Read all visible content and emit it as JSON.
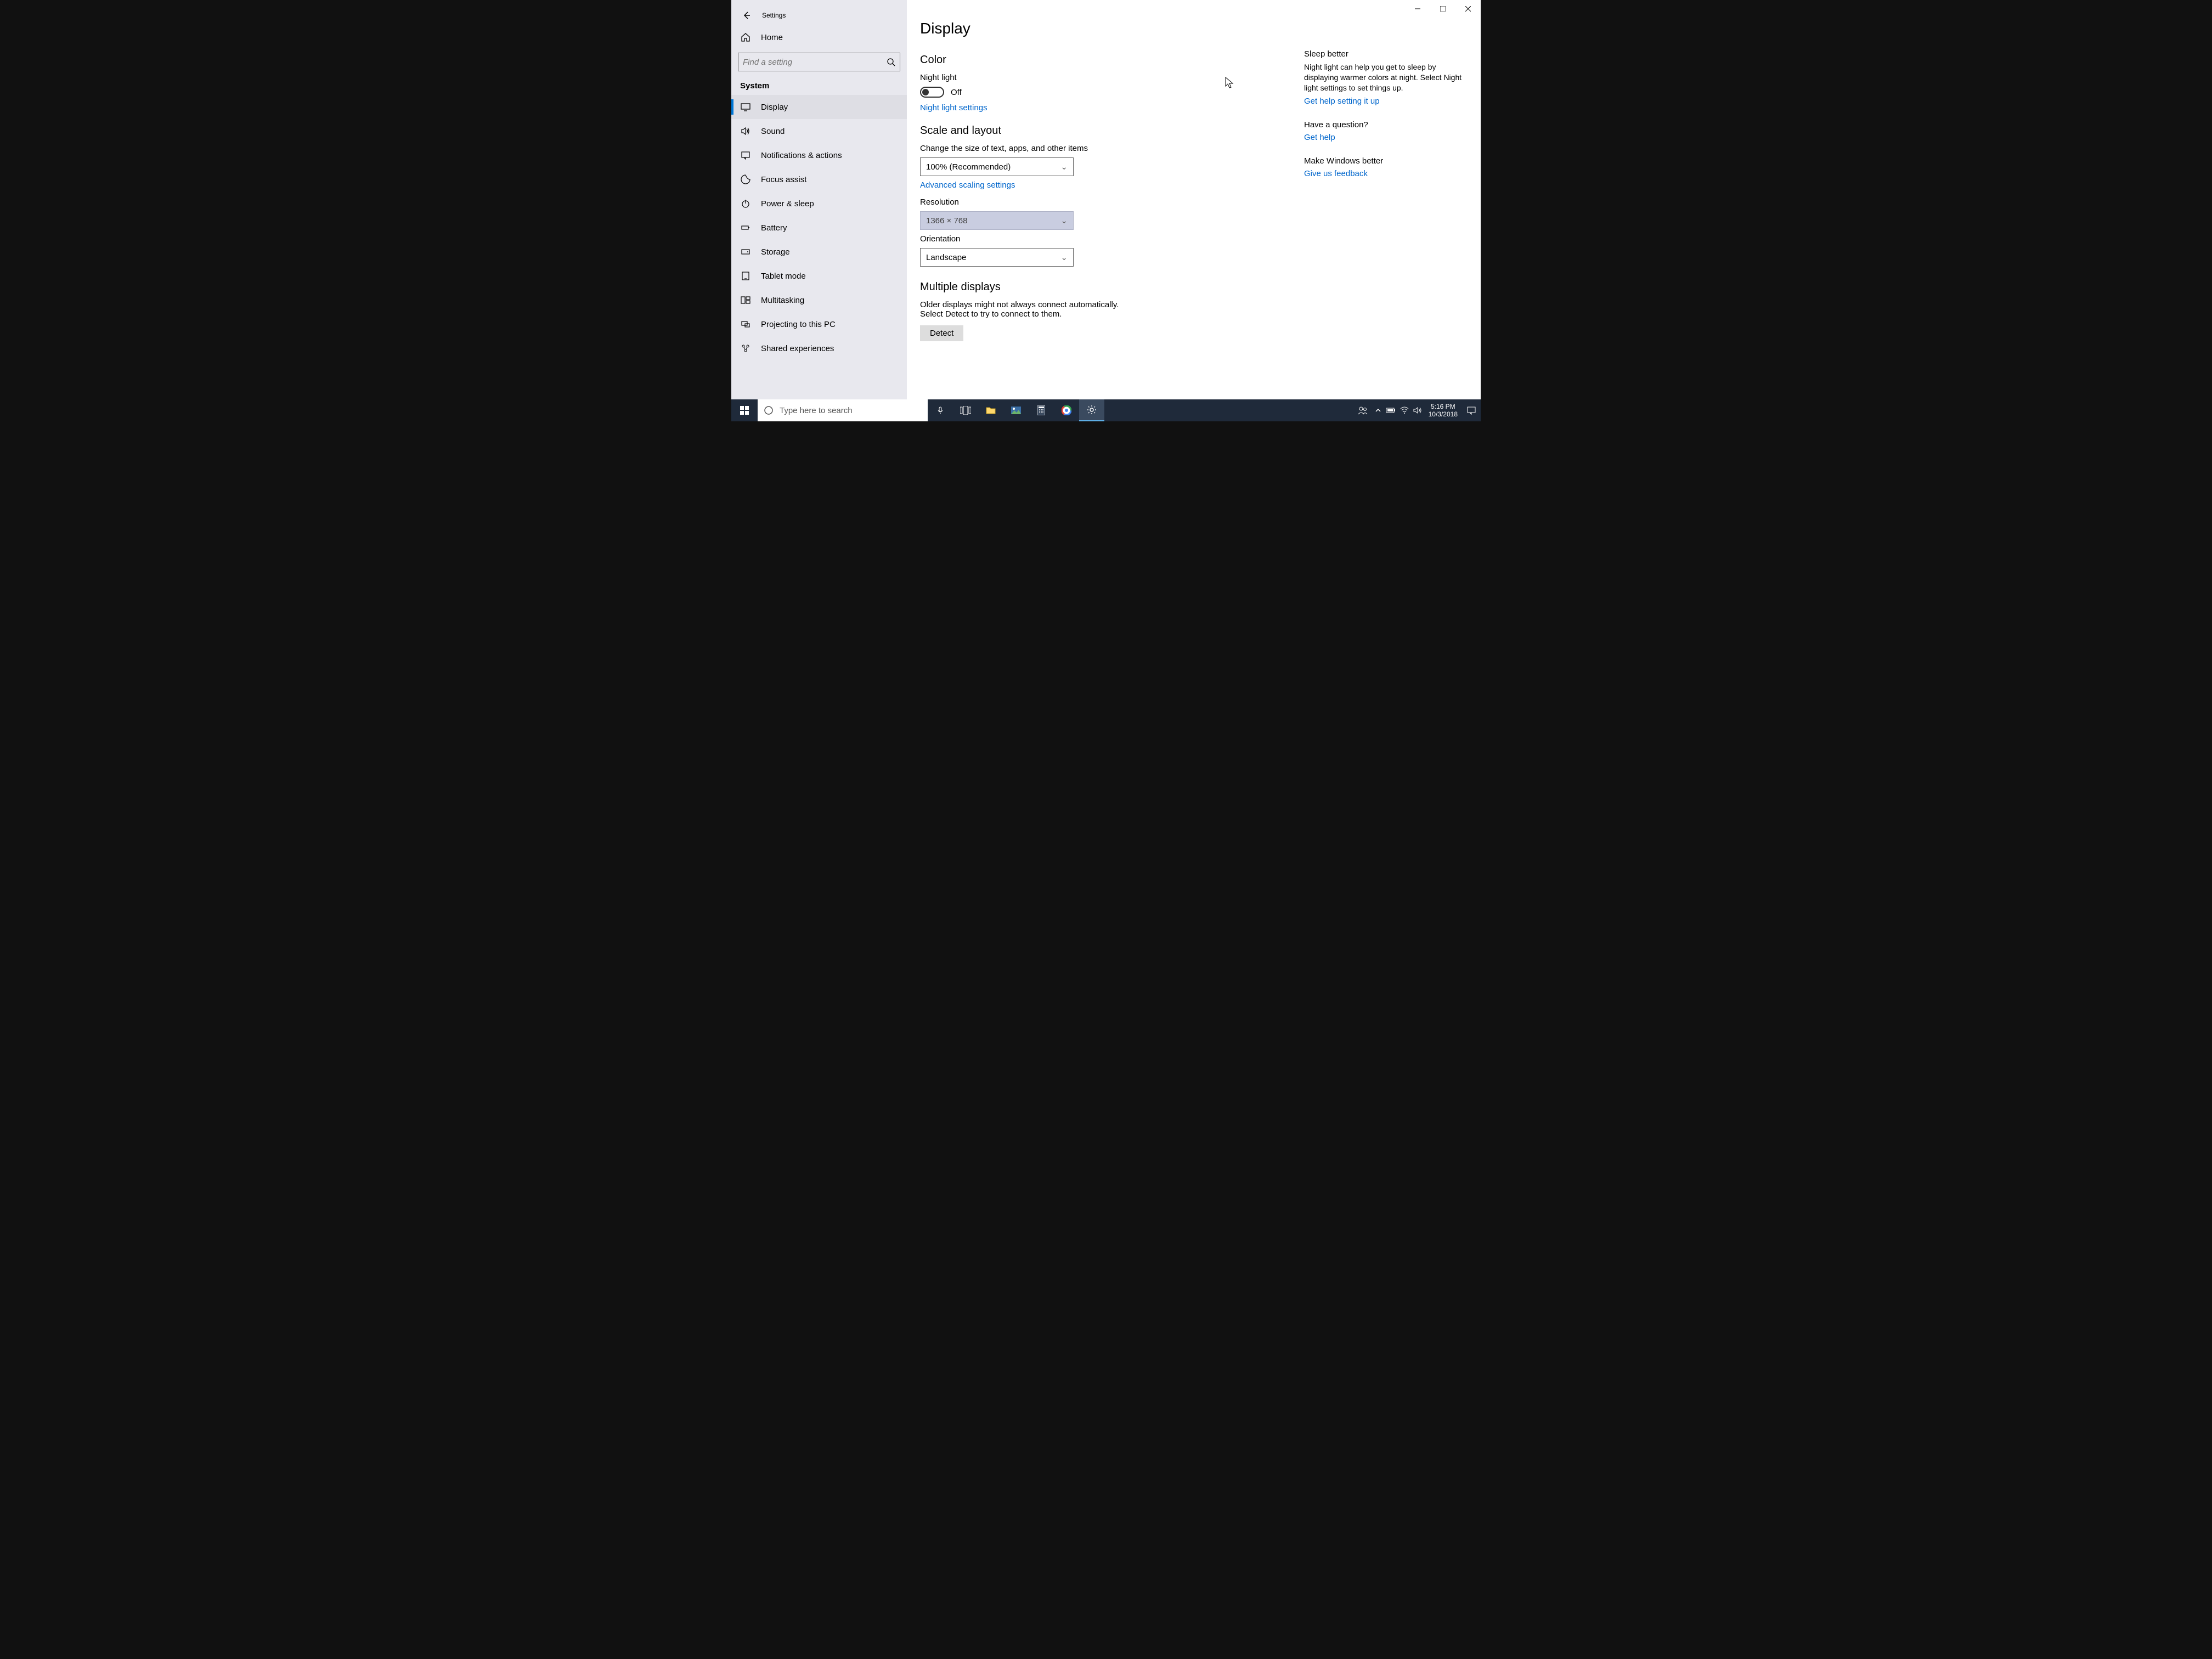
{
  "window": {
    "title": "Settings"
  },
  "sidebar": {
    "home": "Home",
    "search_placeholder": "Find a setting",
    "group": "System",
    "items": [
      {
        "label": "Display"
      },
      {
        "label": "Sound"
      },
      {
        "label": "Notifications & actions"
      },
      {
        "label": "Focus assist"
      },
      {
        "label": "Power & sleep"
      },
      {
        "label": "Battery"
      },
      {
        "label": "Storage"
      },
      {
        "label": "Tablet mode"
      },
      {
        "label": "Multitasking"
      },
      {
        "label": "Projecting to this PC"
      },
      {
        "label": "Shared experiences"
      }
    ]
  },
  "page": {
    "title": "Display",
    "color": {
      "heading": "Color",
      "night_light_label": "Night light",
      "night_light_state": "Off",
      "night_light_settings": "Night light settings"
    },
    "scale": {
      "heading": "Scale and layout",
      "text_size_label": "Change the size of text, apps, and other items",
      "text_size_value": "100% (Recommended)",
      "advanced_link": "Advanced scaling settings",
      "resolution_label": "Resolution",
      "resolution_value": "1366 × 768",
      "orientation_label": "Orientation",
      "orientation_value": "Landscape"
    },
    "multi": {
      "heading": "Multiple displays",
      "desc": "Older displays might not always connect automatically. Select Detect to try to connect to them.",
      "detect": "Detect"
    }
  },
  "aside": {
    "sleep": {
      "title": "Sleep better",
      "body": "Night light can help you get to sleep by displaying warmer colors at night. Select Night light settings to set things up.",
      "link": "Get help setting it up"
    },
    "question": {
      "title": "Have a question?",
      "link": "Get help"
    },
    "feedback": {
      "title": "Make Windows better",
      "link": "Give us feedback"
    }
  },
  "taskbar": {
    "search_placeholder": "Type here to search",
    "time": "5:16 PM",
    "date": "10/3/2018"
  }
}
